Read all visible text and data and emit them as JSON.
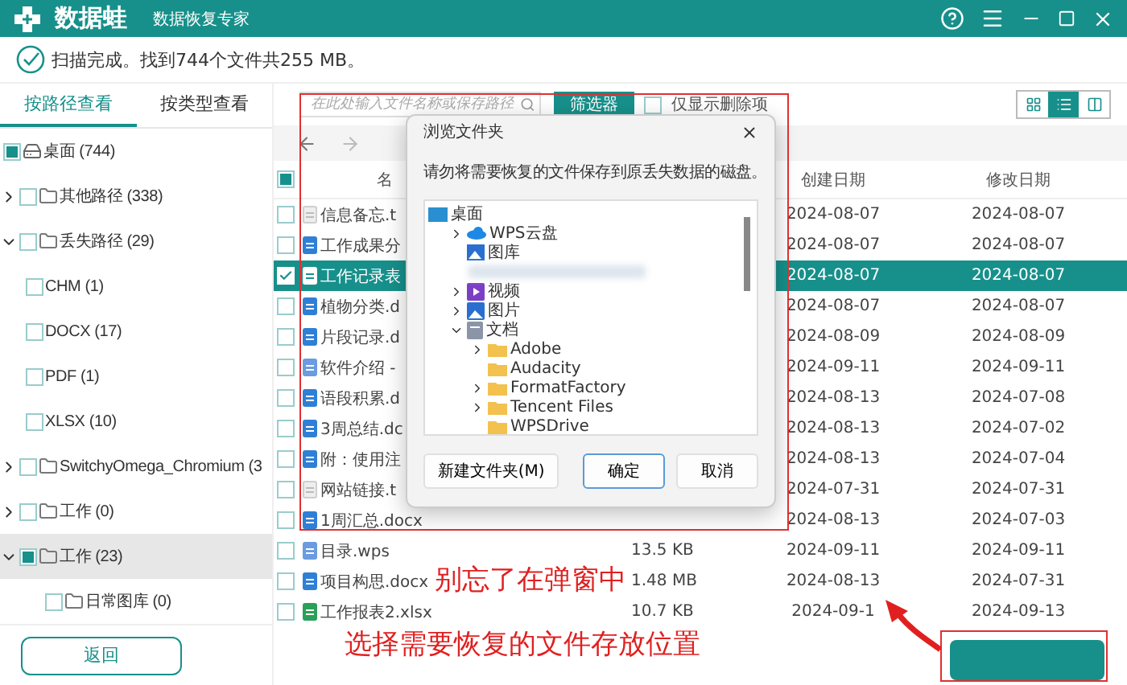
{
  "app": {
    "name": "数据蛙",
    "subtitle": "数据恢复专家"
  },
  "status": "扫描完成。找到744个文件共255 MB。",
  "view_tabs": [
    {
      "label": "按路径查看",
      "selected": true
    },
    {
      "label": "按类型查看",
      "selected": false
    }
  ],
  "tree": [
    {
      "label": "桌面 (744)",
      "kind": "drive",
      "checked": true,
      "selected": false,
      "children": [
        {
          "label": "其他路径 (338)",
          "kind": "folder",
          "checked": false,
          "expanded": false,
          "selected": false
        },
        {
          "label": "丢失路径 (29)",
          "kind": "folder",
          "checked": false,
          "expanded": true,
          "selected": false,
          "children": [
            {
              "label": "CHM (1)",
              "kind": "type",
              "checked": false,
              "selected": false
            },
            {
              "label": "DOCX (17)",
              "kind": "type",
              "checked": false,
              "selected": false
            },
            {
              "label": "PDF (1)",
              "kind": "type",
              "checked": false,
              "selected": false
            },
            {
              "label": "XLSX (10)",
              "kind": "type",
              "checked": false,
              "selected": false
            }
          ]
        },
        {
          "label": "SwitchyOmega_Chromium (3",
          "kind": "folder",
          "checked": false,
          "expanded": false,
          "selected": false
        },
        {
          "label": "工作 (0)",
          "kind": "folder",
          "checked": false,
          "expanded": false,
          "selected": false
        },
        {
          "label": "工作 (23)",
          "kind": "folder",
          "checked": true,
          "expanded": true,
          "selected": true,
          "children": [
            {
              "label": "日常图库 (0)",
              "kind": "folder",
              "checked": false,
              "selected": false
            }
          ]
        }
      ]
    }
  ],
  "search": {
    "placeholder": "在此处输入文件名称或保存路径"
  },
  "filter_button": "筛选器",
  "deleted_only": {
    "label": "仅显示删除项",
    "checked": false
  },
  "view_modes": [
    {
      "kind": "grid",
      "selected": false
    },
    {
      "kind": "list",
      "selected": true
    },
    {
      "kind": "preview",
      "selected": false
    }
  ],
  "table": {
    "all_checked": true,
    "columns": [
      "名",
      "创建日期",
      "修改日期"
    ],
    "rows": [
      {
        "name": "信息备忘.t",
        "kind": "txt",
        "created": "2024-08-07",
        "modified": "2024-08-07",
        "checked": false,
        "selected": false
      },
      {
        "name": "工作成果分",
        "kind": "doc",
        "created": "2024-08-07",
        "modified": "2024-08-07",
        "checked": false,
        "selected": false
      },
      {
        "name": "工作记录表",
        "kind": "sheet",
        "created": "2024-08-07",
        "modified": "2024-08-07",
        "checked": true,
        "selected": true
      },
      {
        "name": "植物分类.d",
        "kind": "doc",
        "created": "2024-08-07",
        "modified": "2024-08-07",
        "checked": false,
        "selected": false
      },
      {
        "name": "片段记录.d",
        "kind": "doc",
        "created": "2024-08-09",
        "modified": "2024-08-09",
        "checked": false,
        "selected": false
      },
      {
        "name": "软件介绍 -",
        "kind": "wps",
        "created": "2024-09-11",
        "modified": "2024-09-11",
        "checked": false,
        "selected": false
      },
      {
        "name": "语段积累.d",
        "kind": "doc",
        "created": "2024-08-13",
        "modified": "2024-07-08",
        "checked": false,
        "selected": false
      },
      {
        "name": "3周总结.dc",
        "kind": "doc",
        "created": "2024-08-13",
        "modified": "2024-07-02",
        "checked": false,
        "selected": false
      },
      {
        "name": "附：使用注",
        "kind": "doc",
        "created": "2024-08-13",
        "modified": "2024-07-04",
        "checked": false,
        "selected": false
      },
      {
        "name": "网站链接.t",
        "kind": "txt",
        "created": "2024-07-31",
        "modified": "2024-07-31",
        "checked": false,
        "selected": false
      },
      {
        "name": "1周汇总.docx",
        "kind": "doc",
        "created": "2024-08-13",
        "modified": "2024-07-03",
        "checked": false,
        "selected": false
      },
      {
        "name": "目录.wps",
        "kind": "wps",
        "size": "13.5 KB",
        "created": "2024-09-11",
        "modified": "2024-09-11",
        "checked": false,
        "selected": false
      },
      {
        "name": "项目构思.docx",
        "kind": "doc",
        "size": "1.48 MB",
        "created": "2024-08-13",
        "modified": "2024-07-31",
        "checked": false,
        "selected": false
      },
      {
        "name": "工作报表2.xlsx",
        "kind": "xlsx",
        "size": "10.7 KB",
        "created": "2024-09-1",
        "modified": "2024-09-13",
        "checked": false,
        "selected": false
      }
    ]
  },
  "back_button": "返回",
  "dialog": {
    "title": "浏览文件夹",
    "message": "请勿将需要恢复的文件保存到原丢失数据的磁盘。",
    "folders": [
      {
        "label": "桌面",
        "kind": "desktop",
        "children": [
          {
            "label": "WPS云盘",
            "kind": "cloud",
            "expanded": false
          },
          {
            "label": "图库",
            "kind": "gallery"
          },
          {
            "kind": "blurred"
          },
          {
            "label": "视频",
            "kind": "video",
            "expanded": false
          },
          {
            "label": "图片",
            "kind": "pictures",
            "expanded": false
          },
          {
            "label": "文档",
            "kind": "documents",
            "expanded": true,
            "children": [
              {
                "label": "Adobe",
                "kind": "folder",
                "expanded": false
              },
              {
                "label": "Audacity",
                "kind": "folder"
              },
              {
                "label": "FormatFactory",
                "kind": "folder",
                "expanded": false
              },
              {
                "label": "Tencent Files",
                "kind": "folder",
                "expanded": false
              },
              {
                "label": "WPSDrive",
                "kind": "folder"
              }
            ]
          }
        ]
      }
    ],
    "buttons": [
      {
        "label": "新建文件夹(M)",
        "kind": "new"
      },
      {
        "label": "确定",
        "kind": "default"
      },
      {
        "label": "取消",
        "kind": "cancel"
      }
    ]
  },
  "annotation": {
    "lines": [
      "别忘了在弹窗中",
      "选择需要恢复的文件存放位置"
    ]
  }
}
